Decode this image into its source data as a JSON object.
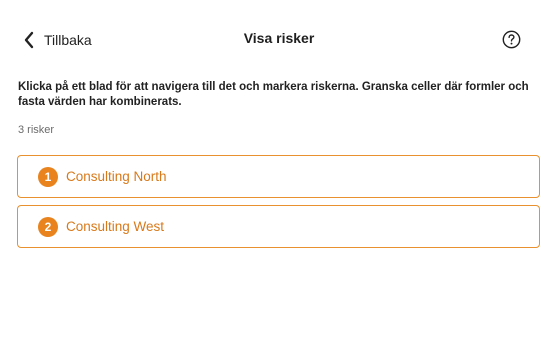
{
  "header": {
    "back_label": "Tillbaka",
    "title": "Visa risker",
    "back_icon": "chevron-left-icon",
    "help_icon": "question-circle-icon"
  },
  "description": "Klicka på ett blad för att navigera till det och markera riskerna. Granska celler där formler och fasta värden har kombinerats.",
  "count_label": "3 risker",
  "risks": [
    {
      "number": "1",
      "name": "Consulting North"
    },
    {
      "number": "2",
      "name": "Consulting West"
    }
  ],
  "colors": {
    "accent": "#e8831e",
    "accent_text": "#d8791a",
    "border": "#e8912e",
    "muted_text": "#6b6b6b"
  }
}
